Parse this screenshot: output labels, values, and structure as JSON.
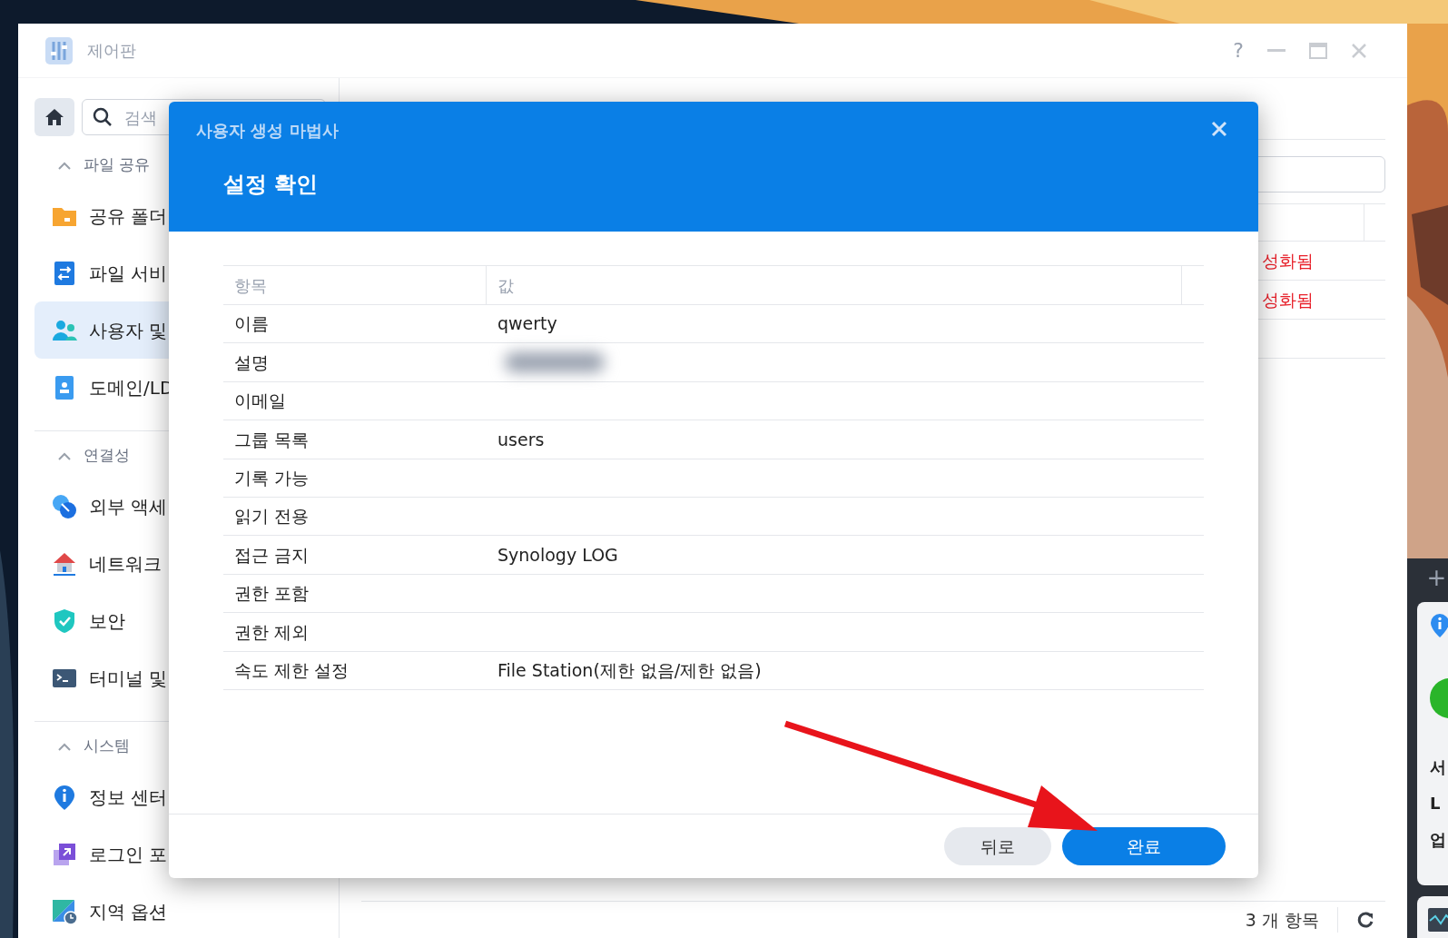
{
  "window": {
    "title": "제어판",
    "help": "?"
  },
  "sidebar": {
    "search": {
      "placeholder": "검색"
    },
    "sections": [
      {
        "title": "파일 공유",
        "expanded": true,
        "items": [
          {
            "label": "공유 폴더",
            "selected": false
          },
          {
            "label": "파일 서비",
            "selected": false
          },
          {
            "label": "사용자 및",
            "selected": true
          },
          {
            "label": "도메인/LD",
            "selected": false
          }
        ]
      },
      {
        "title": "연결성",
        "expanded": true,
        "items": [
          {
            "label": "외부 액세",
            "selected": false
          },
          {
            "label": "네트워크",
            "selected": false
          },
          {
            "label": "보안",
            "selected": false
          },
          {
            "label": "터미널 및",
            "selected": false
          }
        ]
      },
      {
        "title": "시스템",
        "expanded": true,
        "items": [
          {
            "label": "정보 센터",
            "selected": false
          },
          {
            "label": "로그인 포",
            "selected": false
          },
          {
            "label": "지역 옵션",
            "selected": false
          }
        ]
      }
    ]
  },
  "main": {
    "rows": [
      {
        "status": "성화됨"
      },
      {
        "status": "성화됨"
      },
      {}
    ],
    "footer": {
      "count": "3 개 항목"
    }
  },
  "dialog": {
    "subtitle": "사용자 생성 마법사",
    "title": "설정 확인",
    "columns": [
      "항목",
      "값"
    ],
    "rows": [
      {
        "item": "이름",
        "value": "qwerty"
      },
      {
        "item": "설명",
        "redacted": true
      },
      {
        "item": "이메일"
      },
      {
        "item": "그룹 목록",
        "value": "users"
      },
      {
        "item": "기록 가능"
      },
      {
        "item": "읽기 전용"
      },
      {
        "item": "접근 금지",
        "value": "Synology LOG"
      },
      {
        "item": "권한 포함"
      },
      {
        "item": "권한 제외"
      },
      {
        "item": "속도 제한 설정",
        "value": "File Station(제한 없음/제한 없음)"
      }
    ],
    "buttons": [
      {
        "label": "뒤로",
        "kind": "secondary"
      },
      {
        "label": "완료",
        "kind": "primary"
      }
    ]
  },
  "widget": {
    "add": "+",
    "lines": [
      "서",
      "L",
      "업"
    ]
  }
}
